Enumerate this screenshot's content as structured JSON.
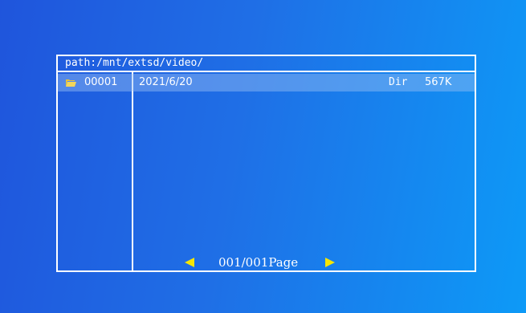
{
  "file_browser": {
    "path": "path:/mnt/extsd/video/",
    "rows": [
      {
        "icon": "folder-icon",
        "name": "00001",
        "date": "2021/6/20",
        "type": "Dir",
        "size": "567K"
      }
    ],
    "pager": {
      "prev_icon": "left-arrow-icon",
      "next_icon": "right-arrow-icon",
      "text": "001/001Page"
    }
  },
  "colors": {
    "background_start": "#1f55dc",
    "background_end": "#0d9af7",
    "selection": "#96bef5",
    "arrow": "#f7e600",
    "border": "#ffffff"
  }
}
